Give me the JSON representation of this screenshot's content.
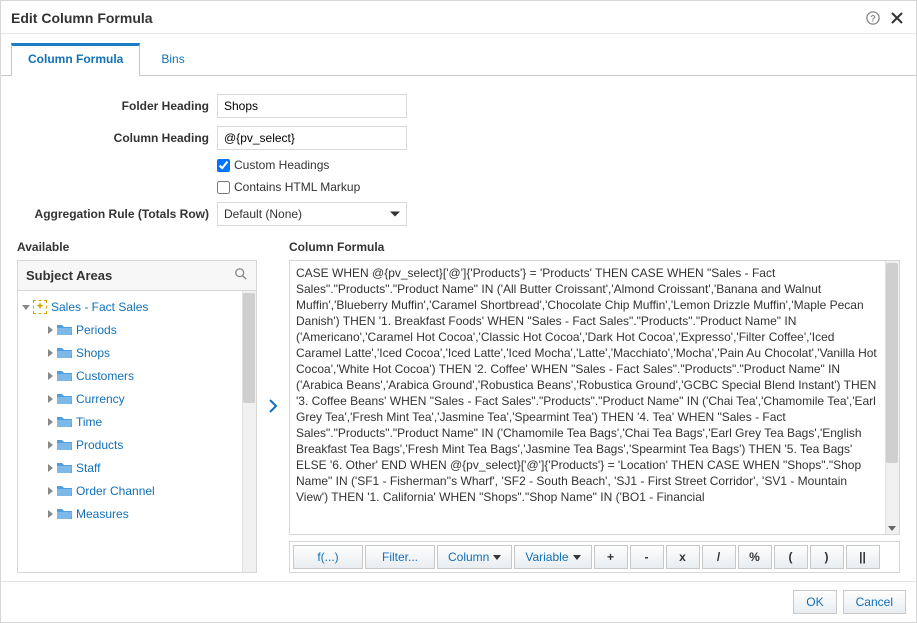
{
  "dialog": {
    "title": "Edit Column Formula"
  },
  "tabs": {
    "formula": "Column Formula",
    "bins": "Bins"
  },
  "labels": {
    "folder_heading": "Folder Heading",
    "column_heading": "Column Heading",
    "custom_headings": "Custom Headings",
    "contains_html": "Contains HTML Markup",
    "aggregation": "Aggregation Rule (Totals Row)",
    "available": "Available",
    "subject_areas": "Subject Areas",
    "column_formula": "Column Formula"
  },
  "values": {
    "folder_heading": "Shops",
    "column_heading": "@{pv_select}",
    "aggregation_selected": "Default (None)"
  },
  "checkboxes": {
    "custom_headings": true,
    "contains_html": false
  },
  "tree": {
    "root": "Sales - Fact Sales",
    "children": [
      "Periods",
      "Shops",
      "Customers",
      "Currency",
      "Time",
      "Products",
      "Staff",
      "Order Channel",
      "Measures"
    ]
  },
  "formula": "CASE WHEN @{pv_select}['@']{'Products'} = 'Products' THEN  CASE WHEN \"Sales - Fact Sales\".\"Products\".\"Product Name\" IN ('All Butter Croissant','Almond Croissant','Banana and Walnut Muffin','Blueberry Muffin','Caramel Shortbread','Chocolate Chip Muffin','Lemon Drizzle Muffin','Maple Pecan Danish') THEN '1. Breakfast Foods' WHEN \"Sales - Fact Sales\".\"Products\".\"Product Name\" IN ('Americano','Caramel Hot Cocoa','Classic Hot Cocoa','Dark Hot Cocoa','Expresso','Filter Coffee','Iced Caramel Latte','Iced Cocoa','Iced Latte','Iced Mocha','Latte','Macchiato','Mocha','Pain Au Chocolat','Vanilla Hot Cocoa','White Hot Cocoa') THEN '2. Coffee' WHEN \"Sales - Fact Sales\".\"Products\".\"Product Name\" IN ('Arabica Beans','Arabica Ground','Robustica Beans','Robustica Ground','GCBC Special Blend Instant') THEN '3. Coffee Beans' WHEN \"Sales - Fact Sales\".\"Products\".\"Product Name\" IN ('Chai Tea','Chamomile Tea','Earl Grey Tea','Fresh Mint Tea','Jasmine Tea','Spearmint Tea') THEN '4. Tea' WHEN \"Sales - Fact Sales\".\"Products\".\"Product Name\" IN ('Chamomile Tea Bags','Chai Tea Bags','Earl Grey Tea Bags','English Breakfast Tea Bags','Fresh Mint Tea Bags','Jasmine Tea Bags','Spearmint Tea Bags') THEN '5. Tea Bags' ELSE '6. Other' END  WHEN @{pv_select}['@']{'Products'} = 'Location'  THEN  CASE  WHEN \"Shops\".\"Shop Name\" IN ('SF1 - Fisherman''s Wharf', 'SF2 - South Beach', 'SJ1 - First Street Corridor', 'SV1 - Mountain View') THEN '1. California' WHEN \"Shops\".\"Shop Name\" IN ('BO1 - Financial",
  "toolbar": {
    "fx": "f(...)",
    "filter": "Filter...",
    "column": "Column",
    "variable": "Variable",
    "plus": "+",
    "minus": "-",
    "mult": "x",
    "div": "/",
    "pct": "%",
    "lparen": "(",
    "rparen": ")",
    "concat": "||"
  },
  "footer": {
    "ok": "OK",
    "cancel": "Cancel"
  }
}
